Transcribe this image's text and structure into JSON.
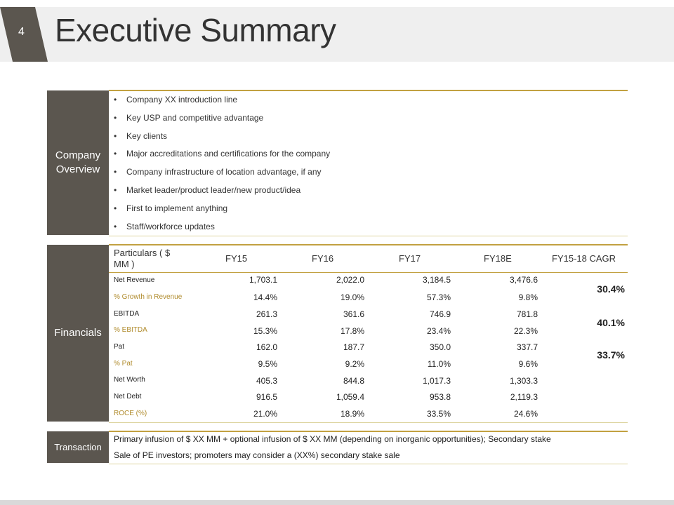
{
  "slide": {
    "number": "4",
    "title": "Executive Summary"
  },
  "company_overview": {
    "label": "Company Overview",
    "bullets": [
      "Company XX introduction line",
      "Key USP and competitive advantage",
      "Key clients",
      "Major accreditations and certifications for the company",
      "Company infrastructure of location advantage, if any",
      "Market leader/product leader/new product/idea",
      "First to implement anything",
      "Staff/workforce updates"
    ]
  },
  "financials": {
    "label": "Financials",
    "headers": [
      "Particulars ( $ MM )",
      "FY15",
      "FY16",
      "FY17",
      "FY18E",
      "FY15-18 CAGR"
    ],
    "rows": [
      {
        "label": "Net Revenue",
        "values": [
          "1,703.1",
          "2,022.0",
          "3,184.5",
          "3,476.6"
        ]
      },
      {
        "label": "% Growth in Revenue",
        "values": [
          "14.4%",
          "19.0%",
          "57.3%",
          "9.8%"
        ]
      },
      {
        "label": "EBITDA",
        "values": [
          "261.3",
          "361.6",
          "746.9",
          "781.8"
        ]
      },
      {
        "label": "% EBITDA",
        "values": [
          "15.3%",
          "17.8%",
          "23.4%",
          "22.3%"
        ]
      },
      {
        "label": "Pat",
        "values": [
          "162.0",
          "187.7",
          "350.0",
          "337.7"
        ]
      },
      {
        "label": "% Pat",
        "values": [
          "9.5%",
          "9.2%",
          "11.0%",
          "9.6%"
        ]
      },
      {
        "label": "Net Worth",
        "values": [
          "405.3",
          "844.8",
          "1,017.3",
          "1,303.3"
        ]
      },
      {
        "label": "Net Debt",
        "values": [
          "916.5",
          "1,059.4",
          "953.8",
          "2,119.3"
        ]
      },
      {
        "label": "ROCE (%)",
        "values": [
          "21.0%",
          "18.9%",
          "33.5%",
          "24.6%"
        ]
      }
    ],
    "cagr": [
      "30.4%",
      "40.1%",
      "33.7%"
    ]
  },
  "transaction": {
    "label": "Transaction",
    "lines": [
      "Primary infusion of $ XX MM + optional infusion of $ XX MM (depending on inorganic opportunities); Secondary stake",
      "Sale of PE investors; promoters may consider a (XX%) secondary stake sale"
    ]
  },
  "colors": {
    "accent": "#c2a141",
    "label_bg": "#5b564f",
    "highlight_text": "#b08b2c"
  }
}
